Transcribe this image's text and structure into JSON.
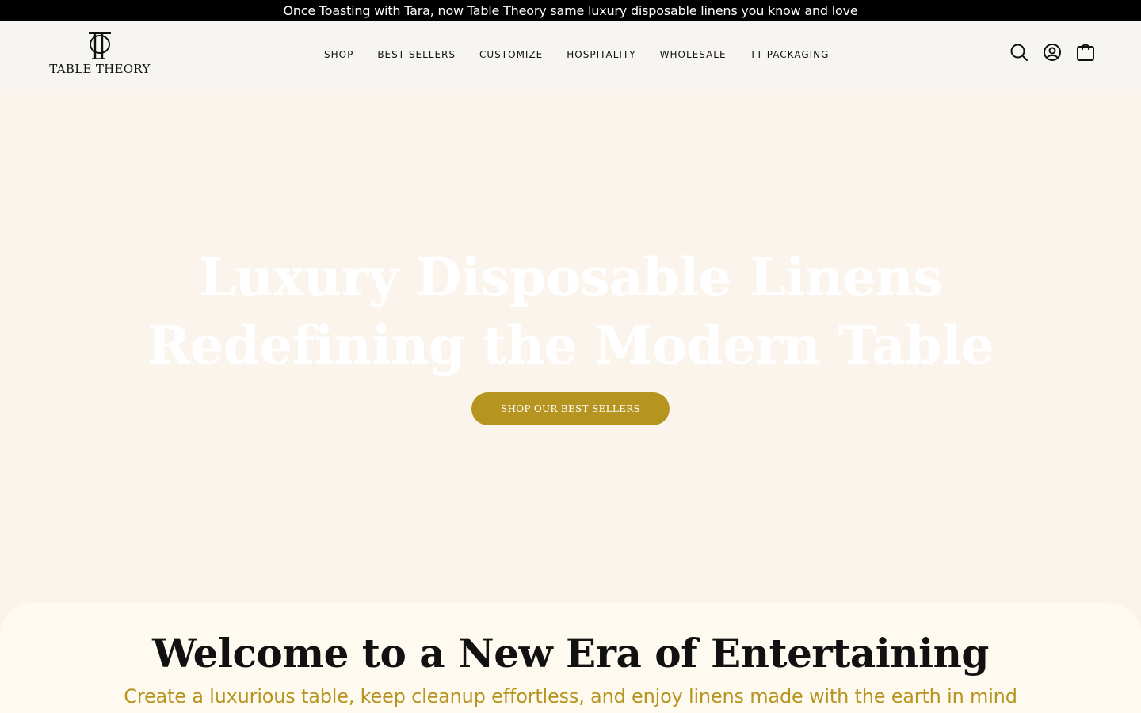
{
  "announcement": {
    "text": "Once Toasting with Tara, now Table Theory same luxury disposable linens you know and love"
  },
  "header": {
    "logo": {
      "text": "TABLE THEORY",
      "icon": "tt-monogram"
    },
    "nav": [
      {
        "label": "SHOP"
      },
      {
        "label": "BEST SELLERS"
      },
      {
        "label": "CUSTOMIZE"
      },
      {
        "label": "HOSPITALITY"
      },
      {
        "label": "WHOLESALE"
      },
      {
        "label": "TT PACKAGING"
      }
    ],
    "icons": [
      "search-icon",
      "account-icon",
      "cart-icon"
    ]
  },
  "hero": {
    "title_line1": "Luxury Disposable Linens",
    "title_line2": "Redefining the Modern Table",
    "cta_label": "SHOP OUR BEST SELLERS"
  },
  "welcome": {
    "title": "Welcome to a New Era of Entertaining",
    "subtitle": "Create a luxurious table, keep cleanup effortless, and enjoy linens made with the earth in mind"
  },
  "colors": {
    "accent": "#b69420",
    "announcement_bg": "#000000",
    "header_bg": "#f6f5f2",
    "hero_bg": "#faf4ec",
    "welcome_bg": "#fffaf0"
  }
}
